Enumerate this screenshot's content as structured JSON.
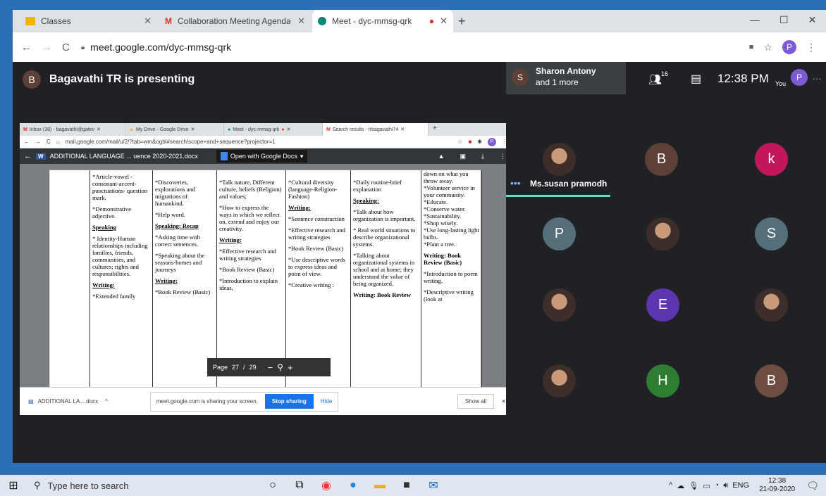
{
  "outer_browser": {
    "tabs": [
      {
        "title": "Classes",
        "icon": "classroom-icon"
      },
      {
        "title": "Collaboration Meeting Agenda -",
        "icon": "gmail-icon"
      },
      {
        "title": "Meet - dyc-mmsg-qrk",
        "icon": "meet-icon",
        "active": true
      }
    ],
    "url": "meet.google.com/dyc-mmsg-qrk",
    "profile_initial": "P"
  },
  "meet": {
    "presenter_initial": "B",
    "presenting_text": "Bagavathi TR is presenting",
    "pinned": {
      "initial": "S",
      "name": "Sharon Antony",
      "more": "and 1 more"
    },
    "participant_count": "16",
    "time": "12:38 PM",
    "self_label": "You",
    "self_initial": "P",
    "active_speaker": "Ms.susan pramodh",
    "tiles": [
      {
        "initial": "",
        "photo": true
      },
      {
        "initial": "B",
        "color": "#5d4037"
      },
      {
        "initial": "k",
        "color": "#c2185b"
      },
      {
        "initial": "P",
        "color": "#546e7a"
      },
      {
        "initial": "",
        "photo": true
      },
      {
        "initial": "S",
        "color": "#546e7a"
      },
      {
        "initial": "",
        "photo": true
      },
      {
        "initial": "E",
        "color": "#5e35b1"
      },
      {
        "initial": "",
        "photo": true
      },
      {
        "initial": "",
        "photo": true
      },
      {
        "initial": "H",
        "color": "#2e7d32"
      },
      {
        "initial": "B",
        "color": "#6d4c41"
      }
    ]
  },
  "inner": {
    "tabs": [
      "Inbox (38) - bagavathi@gatev",
      "My Drive - Google Drive",
      "Meet - dyc-mmsg-qrk",
      "Search results - trbagavathi74"
    ],
    "url": "mail.google.com/mail/u/2/?tab=wm&ogbl#search/scope+and+sequence?projector=1",
    "doc_title": "ADDITIONAL LANGUAGE ... uence 2020-2021.docx",
    "open_with": "Open with Google Docs",
    "page_label": "Page",
    "page_current": "27",
    "page_sep": "/",
    "page_total": "29",
    "download_file": "ADDITIONAL LA....docx",
    "sharing_text": "meet.google.com is sharing your screen.",
    "stop_sharing": "Stop sharing",
    "hide": "Hide",
    "show_all": "Show all"
  },
  "doc": {
    "col1": [
      "*Article-vowel - consonant-accent- punctuations- question mark.",
      "*Demonstrative adjective.",
      "Speaking",
      "* Identity-Human relationships including families, friends, communities, and cultures; rights and responsibilities.",
      "Writing:",
      "*Extended family"
    ],
    "col2": [
      "*Discoveries, explorations and migrations of humankind.",
      "*Help word.",
      "Speaking: Recap",
      "*Asking time with correct sentences.",
      "*Speaking about the seasons-homes and journeys",
      "Writing:",
      "*Book Review (Basic)"
    ],
    "col3": [
      "*Talk nature, Different culture, beliefs (Religion) and values;",
      "*How to express the ways in which we reflect on, extend and enjoy our creativity.",
      "Writing:",
      "*Effective research and writing strategies",
      "*Book Review (Basic)",
      "*Introduction to explain ideas,"
    ],
    "col4": [
      "*Cultural diversity (language-Religion- Fashion)",
      "Writing:",
      "*Sentence construction",
      "*Effective research and writing strategies",
      "*Book Review (Basic)",
      "*Use descriptive words to express ideas and point of view.",
      "*Creative writing :"
    ],
    "col5": [
      "*Daily routine-brief explanation",
      "Speaking:",
      "*Talk about how organization is important.",
      "* Real world situations to describe organizational systems.",
      "*Talking about organizational systems in school and at home; they understand the value of being organized.",
      "Writing: Book Review"
    ],
    "col6": [
      "down on what you throw away.",
      "*Volunteer service in your community.",
      "*Educate.",
      "*Conserve water.",
      "*Sustainability.",
      "*Shop wisely.",
      "*Use long-lasting light bulbs.",
      "*Plant a tree.",
      "Writing: Book Review (Basic)",
      "*Introduction to poem writing.",
      "*Descriptive writing (look at"
    ]
  },
  "taskbar": {
    "search_placeholder": "Type here to search",
    "lang": "ENG",
    "time": "12:38",
    "date": "21-09-2020"
  }
}
